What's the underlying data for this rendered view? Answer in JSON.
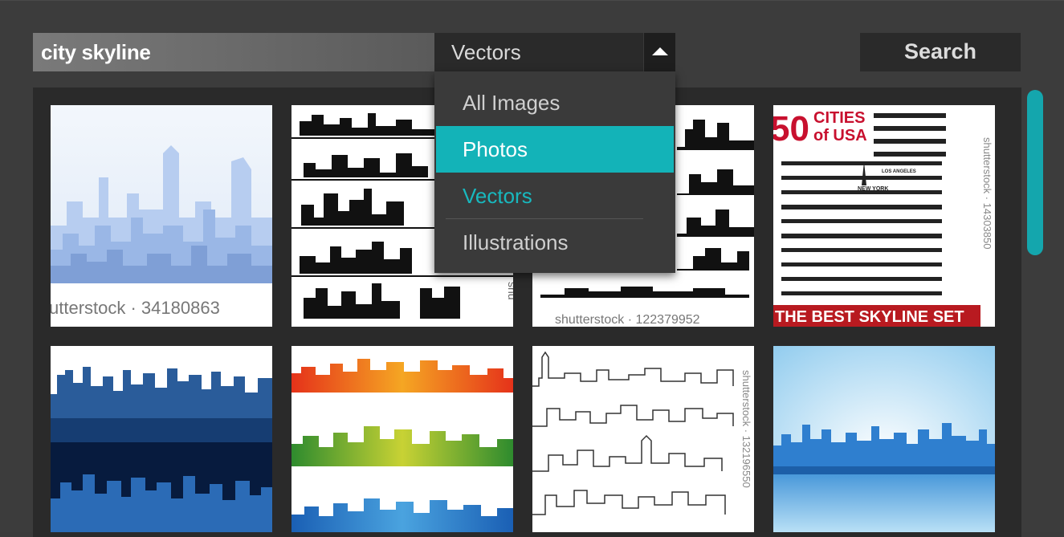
{
  "search": {
    "query": "city skyline",
    "button_label": "Search"
  },
  "type_select": {
    "selected": "Vectors",
    "options": [
      "All Images",
      "Photos",
      "Vectors",
      "Illustrations"
    ],
    "highlighted": "Photos"
  },
  "results": {
    "thumbnails": [
      {
        "watermark": "utterstock · 34180863"
      },
      {
        "watermark": "shu"
      },
      {
        "watermark": "shutterstock · 122379952"
      },
      {
        "title_num": "50",
        "title_line1": "CITIES",
        "title_line2": "of USA",
        "banner": "THE BEST SKYLINE SET",
        "labels": [
          "LOS ANGELES",
          "NEW YORK"
        ],
        "watermark": "shutterstock · 14303850"
      },
      {
        "watermark": ""
      },
      {
        "watermark": ""
      },
      {
        "watermark": "shutterstock · 132196550"
      },
      {
        "watermark": ""
      }
    ]
  },
  "colors": {
    "accent": "#13b3b8",
    "background": "#3c3c3c",
    "panel": "#2a2a2a"
  },
  "icons": {
    "select_arrow": "triangle-up-icon"
  }
}
